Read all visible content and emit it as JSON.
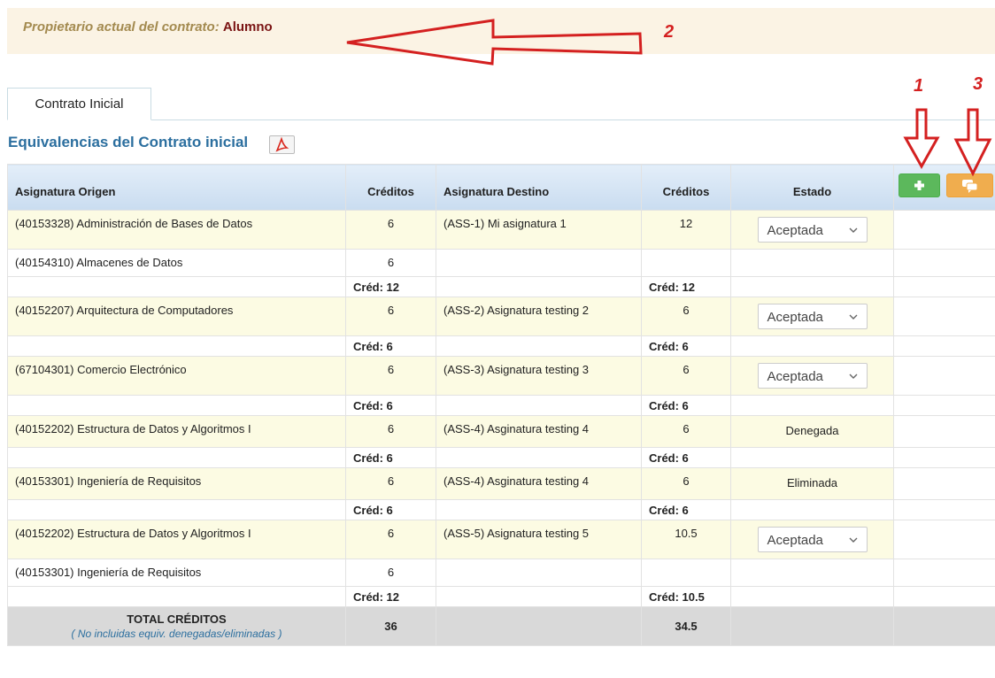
{
  "owner": {
    "label": "Propietario actual del contrato:",
    "value": "Alumno"
  },
  "annotations": {
    "n1": "1",
    "n2": "2",
    "n3": "3",
    "arrow_color": "#d42020"
  },
  "tab": {
    "label": "Contrato Inicial"
  },
  "section": {
    "title": "Equivalencias del Contrato inicial",
    "pdf_icon": "pdf-icon"
  },
  "buttons": {
    "add_icon": "plus-icon",
    "comment_icon": "comments-icon"
  },
  "colors": {
    "add": "#5cb85c",
    "comment": "#f0ad4e",
    "title": "#2c6f9f"
  },
  "table": {
    "headers": {
      "origen": "Asignatura Origen",
      "creditos1": "Créditos",
      "destino": "Asignatura Destino",
      "creditos2": "Créditos",
      "estado": "Estado"
    },
    "groups": [
      {
        "main": {
          "origen": "(40153328) Administración de Bases de Datos",
          "c1": "6",
          "destino": "(ASS-1) Mi asignatura 1",
          "c2": "12",
          "estado": "Aceptada"
        },
        "extra": {
          "origen": "(40154310) Almacenes de Datos",
          "c1": "6"
        },
        "sum": {
          "c1": "Créd: 12",
          "c2": "Créd: 12"
        }
      },
      {
        "main": {
          "origen": "(40152207) Arquitectura de Computadores",
          "c1": "6",
          "destino": "(ASS-2) Asignatura testing 2",
          "c2": "6",
          "estado": "Aceptada"
        },
        "sum": {
          "c1": "Créd: 6",
          "c2": "Créd: 6"
        }
      },
      {
        "main": {
          "origen": "(67104301) Comercio Electrónico",
          "c1": "6",
          "destino": "(ASS-3) Asignatura testing 3",
          "c2": "6",
          "estado": "Aceptada"
        },
        "sum": {
          "c1": "Créd: 6",
          "c2": "Créd: 6"
        }
      },
      {
        "main": {
          "origen": "(40152202) Estructura de Datos y Algoritmos I",
          "c1": "6",
          "destino": "(ASS-4) Asginatura testing 4",
          "c2": "6",
          "estado": "Denegada"
        },
        "sum": {
          "c1": "Créd: 6",
          "c2": "Créd: 6"
        }
      },
      {
        "main": {
          "origen": "(40153301) Ingeniería de Requisitos",
          "c1": "6",
          "destino": "(ASS-4) Asginatura testing 4",
          "c2": "6",
          "estado": "Eliminada"
        },
        "sum": {
          "c1": "Créd: 6",
          "c2": "Créd: 6"
        }
      },
      {
        "main": {
          "origen": "(40152202) Estructura de Datos y Algoritmos I",
          "c1": "6",
          "destino": "(ASS-5) Asignatura testing 5",
          "c2": "10.5",
          "estado": "Aceptada"
        },
        "extra": {
          "origen": "(40153301) Ingeniería de Requisitos",
          "c1": "6"
        },
        "sum": {
          "c1": "Créd: 12",
          "c2": "Créd: 10.5"
        }
      }
    ],
    "total": {
      "label": "TOTAL CRÉDITOS",
      "note": "( No incluidas equiv. denegadas/eliminadas )",
      "c1": "36",
      "c2": "34.5"
    }
  }
}
